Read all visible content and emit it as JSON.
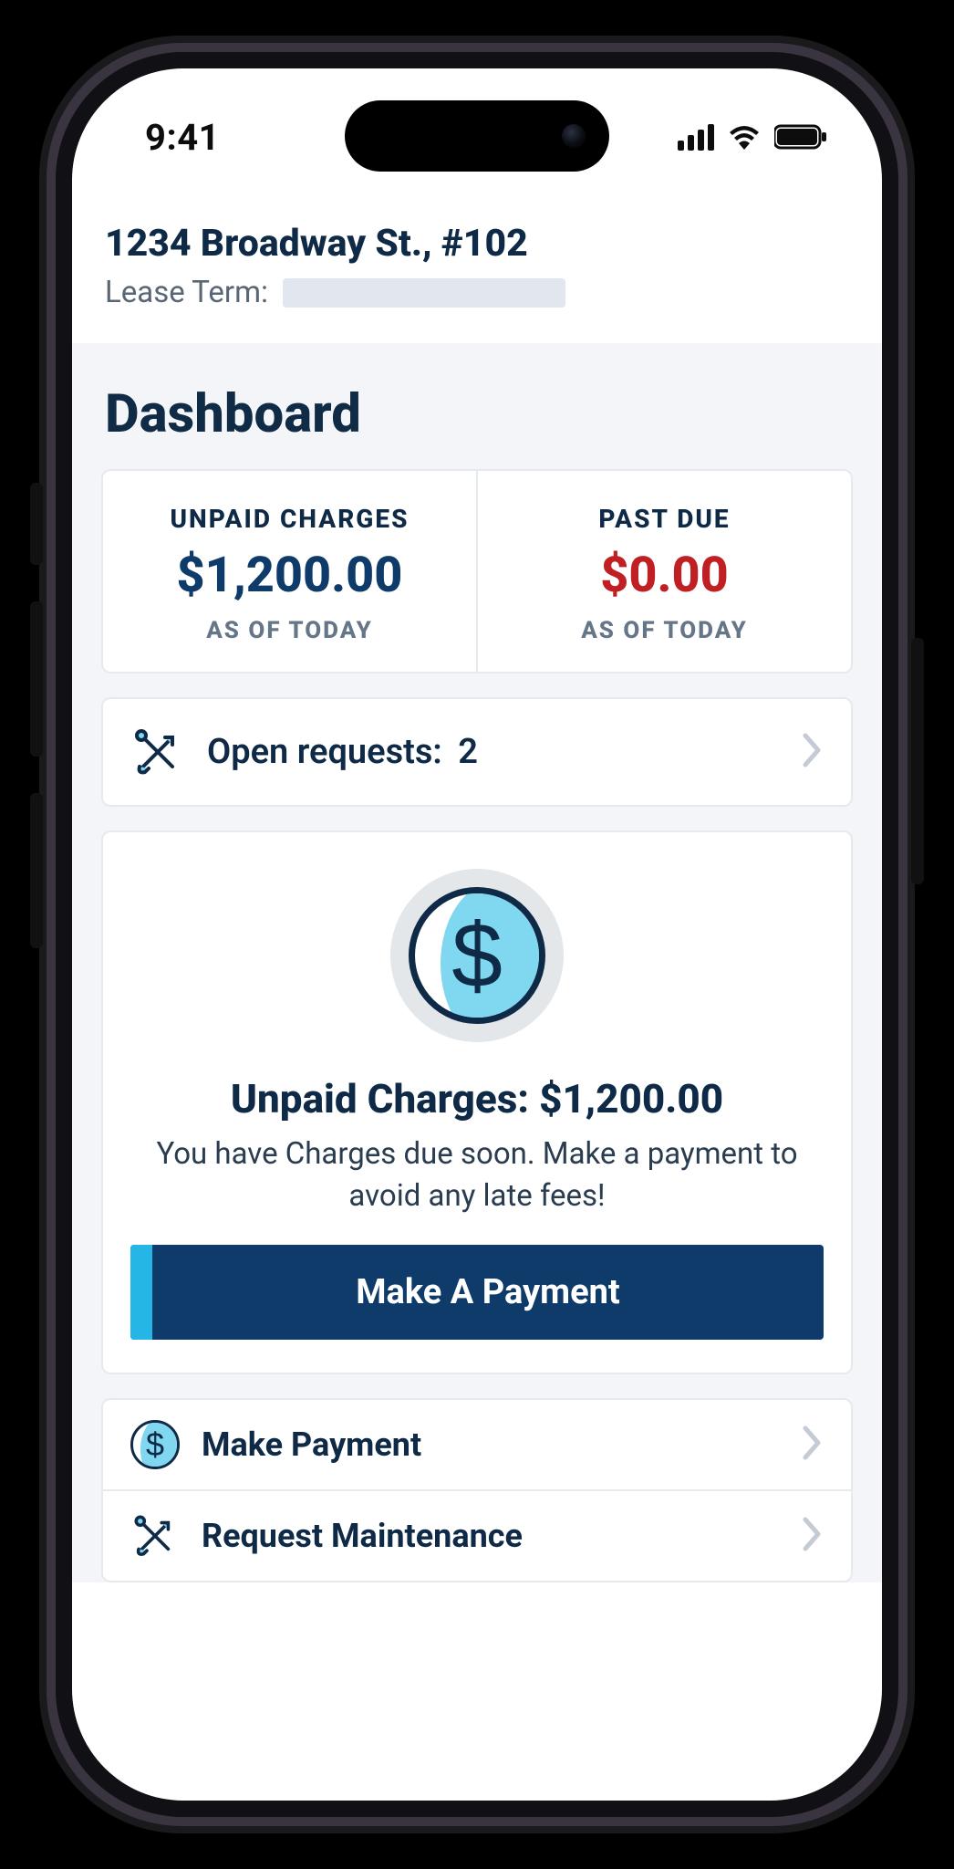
{
  "statusbar": {
    "time": "9:41"
  },
  "header": {
    "address": "1234 Broadway St., #102",
    "lease_term_label": "Lease Term:"
  },
  "page_title": "Dashboard",
  "stats": {
    "unpaid": {
      "label": "UNPAID CHARGES",
      "value": "$1,200.00",
      "sub": "AS OF TODAY"
    },
    "past_due": {
      "label": "PAST DUE",
      "value": "$0.00",
      "sub": "AS OF TODAY"
    }
  },
  "open_requests": {
    "label": "Open requests:",
    "count": "2"
  },
  "hero": {
    "title": "Unpaid Charges: $1,200.00",
    "message": "You have Charges due soon. Make a payment to avoid any late fees!",
    "button": "Make A Payment"
  },
  "actions": {
    "make_payment": "Make Payment",
    "request_maintenance": "Request Maintenance"
  }
}
